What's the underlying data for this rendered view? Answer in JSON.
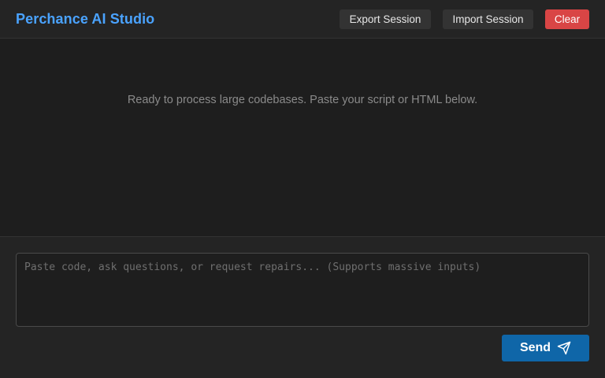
{
  "header": {
    "title": "Perchance AI Studio",
    "buttons": {
      "export": "Export Session",
      "import": "Import Session",
      "clear": "Clear"
    }
  },
  "chat": {
    "empty_message": "Ready to process large codebases. Paste your script or HTML below."
  },
  "composer": {
    "placeholder": "Paste code, ask questions, or request repairs... (Supports massive inputs)",
    "send_label": "Send",
    "send_icon": "send-icon"
  },
  "colors": {
    "accent": "#4aa3ff",
    "send_button": "#0f66a8",
    "clear_button": "#d94545",
    "background": "#1e1e1e",
    "panel": "#242424"
  }
}
